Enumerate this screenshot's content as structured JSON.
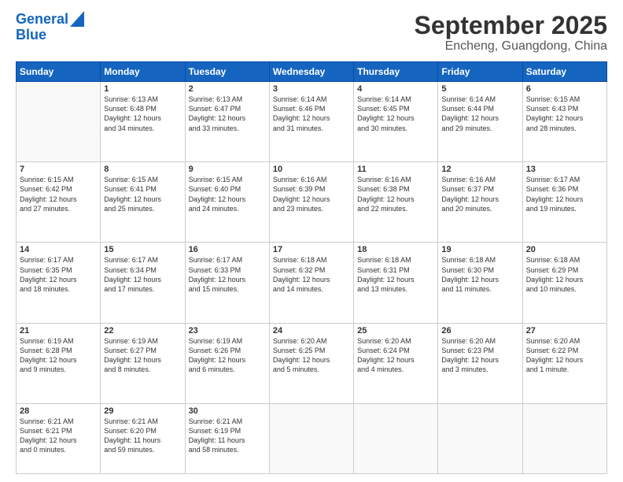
{
  "logo": {
    "line1": "General",
    "line2": "Blue"
  },
  "title": "September 2025",
  "subtitle": "Encheng, Guangdong, China",
  "days_of_week": [
    "Sunday",
    "Monday",
    "Tuesday",
    "Wednesday",
    "Thursday",
    "Friday",
    "Saturday"
  ],
  "weeks": [
    [
      {
        "day": "",
        "info": ""
      },
      {
        "day": "1",
        "info": "Sunrise: 6:13 AM\nSunset: 6:48 PM\nDaylight: 12 hours\nand 34 minutes."
      },
      {
        "day": "2",
        "info": "Sunrise: 6:13 AM\nSunset: 6:47 PM\nDaylight: 12 hours\nand 33 minutes."
      },
      {
        "day": "3",
        "info": "Sunrise: 6:14 AM\nSunset: 6:46 PM\nDaylight: 12 hours\nand 31 minutes."
      },
      {
        "day": "4",
        "info": "Sunrise: 6:14 AM\nSunset: 6:45 PM\nDaylight: 12 hours\nand 30 minutes."
      },
      {
        "day": "5",
        "info": "Sunrise: 6:14 AM\nSunset: 6:44 PM\nDaylight: 12 hours\nand 29 minutes."
      },
      {
        "day": "6",
        "info": "Sunrise: 6:15 AM\nSunset: 6:43 PM\nDaylight: 12 hours\nand 28 minutes."
      }
    ],
    [
      {
        "day": "7",
        "info": "Sunrise: 6:15 AM\nSunset: 6:42 PM\nDaylight: 12 hours\nand 27 minutes."
      },
      {
        "day": "8",
        "info": "Sunrise: 6:15 AM\nSunset: 6:41 PM\nDaylight: 12 hours\nand 25 minutes."
      },
      {
        "day": "9",
        "info": "Sunrise: 6:15 AM\nSunset: 6:40 PM\nDaylight: 12 hours\nand 24 minutes."
      },
      {
        "day": "10",
        "info": "Sunrise: 6:16 AM\nSunset: 6:39 PM\nDaylight: 12 hours\nand 23 minutes."
      },
      {
        "day": "11",
        "info": "Sunrise: 6:16 AM\nSunset: 6:38 PM\nDaylight: 12 hours\nand 22 minutes."
      },
      {
        "day": "12",
        "info": "Sunrise: 6:16 AM\nSunset: 6:37 PM\nDaylight: 12 hours\nand 20 minutes."
      },
      {
        "day": "13",
        "info": "Sunrise: 6:17 AM\nSunset: 6:36 PM\nDaylight: 12 hours\nand 19 minutes."
      }
    ],
    [
      {
        "day": "14",
        "info": "Sunrise: 6:17 AM\nSunset: 6:35 PM\nDaylight: 12 hours\nand 18 minutes."
      },
      {
        "day": "15",
        "info": "Sunrise: 6:17 AM\nSunset: 6:34 PM\nDaylight: 12 hours\nand 17 minutes."
      },
      {
        "day": "16",
        "info": "Sunrise: 6:17 AM\nSunset: 6:33 PM\nDaylight: 12 hours\nand 15 minutes."
      },
      {
        "day": "17",
        "info": "Sunrise: 6:18 AM\nSunset: 6:32 PM\nDaylight: 12 hours\nand 14 minutes."
      },
      {
        "day": "18",
        "info": "Sunrise: 6:18 AM\nSunset: 6:31 PM\nDaylight: 12 hours\nand 13 minutes."
      },
      {
        "day": "19",
        "info": "Sunrise: 6:18 AM\nSunset: 6:30 PM\nDaylight: 12 hours\nand 11 minutes."
      },
      {
        "day": "20",
        "info": "Sunrise: 6:18 AM\nSunset: 6:29 PM\nDaylight: 12 hours\nand 10 minutes."
      }
    ],
    [
      {
        "day": "21",
        "info": "Sunrise: 6:19 AM\nSunset: 6:28 PM\nDaylight: 12 hours\nand 9 minutes."
      },
      {
        "day": "22",
        "info": "Sunrise: 6:19 AM\nSunset: 6:27 PM\nDaylight: 12 hours\nand 8 minutes."
      },
      {
        "day": "23",
        "info": "Sunrise: 6:19 AM\nSunset: 6:26 PM\nDaylight: 12 hours\nand 6 minutes."
      },
      {
        "day": "24",
        "info": "Sunrise: 6:20 AM\nSunset: 6:25 PM\nDaylight: 12 hours\nand 5 minutes."
      },
      {
        "day": "25",
        "info": "Sunrise: 6:20 AM\nSunset: 6:24 PM\nDaylight: 12 hours\nand 4 minutes."
      },
      {
        "day": "26",
        "info": "Sunrise: 6:20 AM\nSunset: 6:23 PM\nDaylight: 12 hours\nand 3 minutes."
      },
      {
        "day": "27",
        "info": "Sunrise: 6:20 AM\nSunset: 6:22 PM\nDaylight: 12 hours\nand 1 minute."
      }
    ],
    [
      {
        "day": "28",
        "info": "Sunrise: 6:21 AM\nSunset: 6:21 PM\nDaylight: 12 hours\nand 0 minutes."
      },
      {
        "day": "29",
        "info": "Sunrise: 6:21 AM\nSunset: 6:20 PM\nDaylight: 11 hours\nand 59 minutes."
      },
      {
        "day": "30",
        "info": "Sunrise: 6:21 AM\nSunset: 6:19 PM\nDaylight: 11 hours\nand 58 minutes."
      },
      {
        "day": "",
        "info": ""
      },
      {
        "day": "",
        "info": ""
      },
      {
        "day": "",
        "info": ""
      },
      {
        "day": "",
        "info": ""
      }
    ]
  ]
}
